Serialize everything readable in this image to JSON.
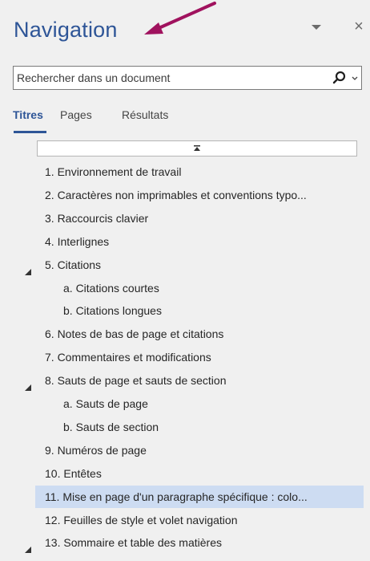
{
  "pane": {
    "title": "Navigation",
    "menu_icon": "chevron-down-icon",
    "close_glyph": "×"
  },
  "search": {
    "placeholder": "Rechercher dans un document",
    "icon": "search-icon",
    "dropdown_icon": "chevron-down-icon"
  },
  "tabs": [
    {
      "label": "Titres",
      "active": true
    },
    {
      "label": "Pages",
      "active": false
    },
    {
      "label": "Résultats",
      "active": false
    }
  ],
  "accent_color": "#2e5597",
  "selected_color": "#cddcf2",
  "headings": [
    {
      "label": "1. Environnement de travail",
      "level": 1,
      "expanded": null,
      "selected": false
    },
    {
      "label": "2. Caractères non imprimables et conventions typo...",
      "level": 1,
      "expanded": null,
      "selected": false
    },
    {
      "label": "3. Raccourcis clavier",
      "level": 1,
      "expanded": null,
      "selected": false
    },
    {
      "label": "4. Interlignes",
      "level": 1,
      "expanded": null,
      "selected": false
    },
    {
      "label": "5. Citations",
      "level": 1,
      "expanded": true,
      "selected": false
    },
    {
      "label": "a. Citations courtes",
      "level": 2,
      "expanded": null,
      "selected": false
    },
    {
      "label": "b. Citations longues",
      "level": 2,
      "expanded": null,
      "selected": false
    },
    {
      "label": "6. Notes de bas de page et citations",
      "level": 1,
      "expanded": null,
      "selected": false
    },
    {
      "label": "7. Commentaires et modifications",
      "level": 1,
      "expanded": null,
      "selected": false
    },
    {
      "label": "8. Sauts de page et sauts de section",
      "level": 1,
      "expanded": true,
      "selected": false
    },
    {
      "label": "a. Sauts de page",
      "level": 2,
      "expanded": null,
      "selected": false
    },
    {
      "label": "b. Sauts de section",
      "level": 2,
      "expanded": null,
      "selected": false
    },
    {
      "label": "9. Numéros de page",
      "level": 1,
      "expanded": null,
      "selected": false
    },
    {
      "label": "10. Entêtes",
      "level": 1,
      "expanded": null,
      "selected": false
    },
    {
      "label": "11. Mise en page d'un paragraphe spécifique : colo...",
      "level": 1,
      "expanded": null,
      "selected": true
    },
    {
      "label": "12. Feuilles de style et volet navigation",
      "level": 1,
      "expanded": null,
      "selected": false
    },
    {
      "label": "13. Sommaire et table des matières",
      "level": 1,
      "expanded": true,
      "selected": false
    }
  ]
}
